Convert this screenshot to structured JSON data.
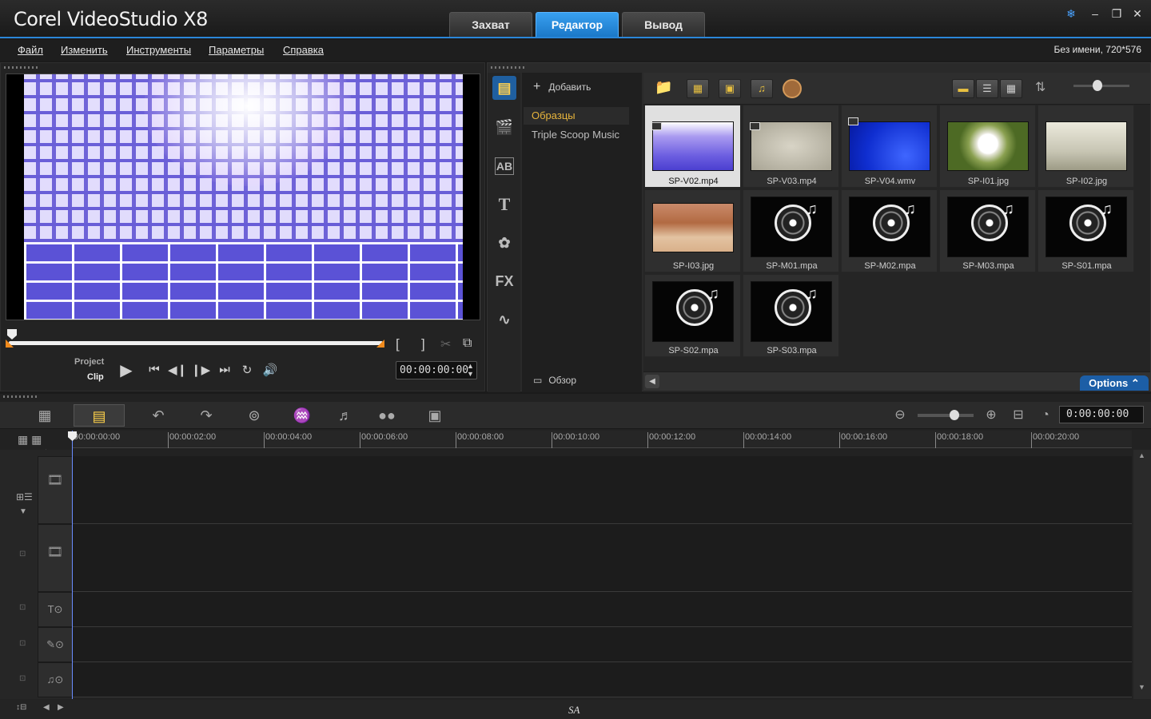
{
  "app": {
    "title": "Corel VideoStudio X8"
  },
  "top_tabs": [
    {
      "label": "Захват"
    },
    {
      "label": "Редактор"
    },
    {
      "label": "Вывод"
    }
  ],
  "menu": [
    {
      "label": "Файл"
    },
    {
      "label": "Изменить"
    },
    {
      "label": "Инструменты"
    },
    {
      "label": "Параметры"
    },
    {
      "label": "Справка"
    }
  ],
  "project_info": "Без имени, 720*576",
  "player": {
    "mode_project": "Project",
    "mode_clip": "Clip",
    "timecode": "00:00:00:00",
    "mark_in": "[",
    "mark_out": "]"
  },
  "library": {
    "add_label": "Добавить",
    "folders": [
      {
        "label": "Образцы",
        "selected": true
      },
      {
        "label": "Triple Scoop Music",
        "selected": false
      }
    ],
    "browse_label": "Обзор",
    "options_label": "Options",
    "items": [
      {
        "name": "SP-V02.mp4",
        "kind": "video"
      },
      {
        "name": "SP-V03.mp4",
        "kind": "video"
      },
      {
        "name": "SP-V04.wmv",
        "kind": "video"
      },
      {
        "name": "SP-I01.jpg",
        "kind": "image"
      },
      {
        "name": "SP-I02.jpg",
        "kind": "image"
      },
      {
        "name": "SP-I03.jpg",
        "kind": "image"
      },
      {
        "name": "SP-M01.mpa",
        "kind": "audio"
      },
      {
        "name": "SP-M02.mpa",
        "kind": "audio"
      },
      {
        "name": "SP-M03.mpa",
        "kind": "audio"
      },
      {
        "name": "SP-S01.mpa",
        "kind": "audio"
      },
      {
        "name": "SP-S02.mpa",
        "kind": "audio"
      },
      {
        "name": "SP-S03.mpa",
        "kind": "audio"
      }
    ]
  },
  "timeline": {
    "timecode": "0:00:00:00",
    "ruler": [
      "00:00:00:00",
      "00:00:02:00",
      "00:00:04:00",
      "00:00:06:00",
      "00:00:08:00",
      "00:00:10:00",
      "00:00:12:00",
      "00:00:14:00",
      "00:00:16:00",
      "00:00:18:00",
      "00:00:20:00"
    ],
    "bottom_label": "SA"
  },
  "colors": {
    "accent": "#2a86d8",
    "options": "#1c5ea6",
    "marker": "#f08a1c"
  }
}
